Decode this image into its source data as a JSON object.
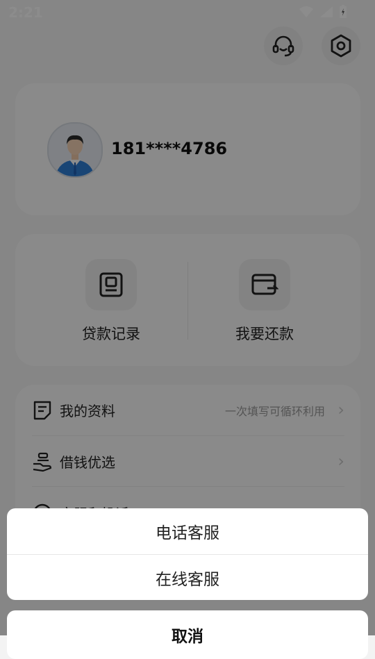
{
  "status_bar": {
    "time": "2:21"
  },
  "header": {
    "support_icon": "headset-icon",
    "settings_icon": "hexagon-settings-icon"
  },
  "profile": {
    "phone": "181****4786",
    "avatar": "user-avatar"
  },
  "actions": [
    {
      "label": "贷款记录",
      "icon": "record-icon"
    },
    {
      "label": "我要还款",
      "icon": "wallet-icon"
    }
  ],
  "menu": [
    {
      "label": "我的资料",
      "hint": "一次填写可循环利用",
      "icon": "document-icon"
    },
    {
      "label": "借钱优选",
      "hint": "",
      "icon": "hand-coin-icon"
    },
    {
      "label": "客服和投诉",
      "hint": "",
      "icon": "chat-icon"
    }
  ],
  "action_sheet": {
    "options": [
      "电话客服",
      "在线客服"
    ],
    "cancel": "取消"
  }
}
